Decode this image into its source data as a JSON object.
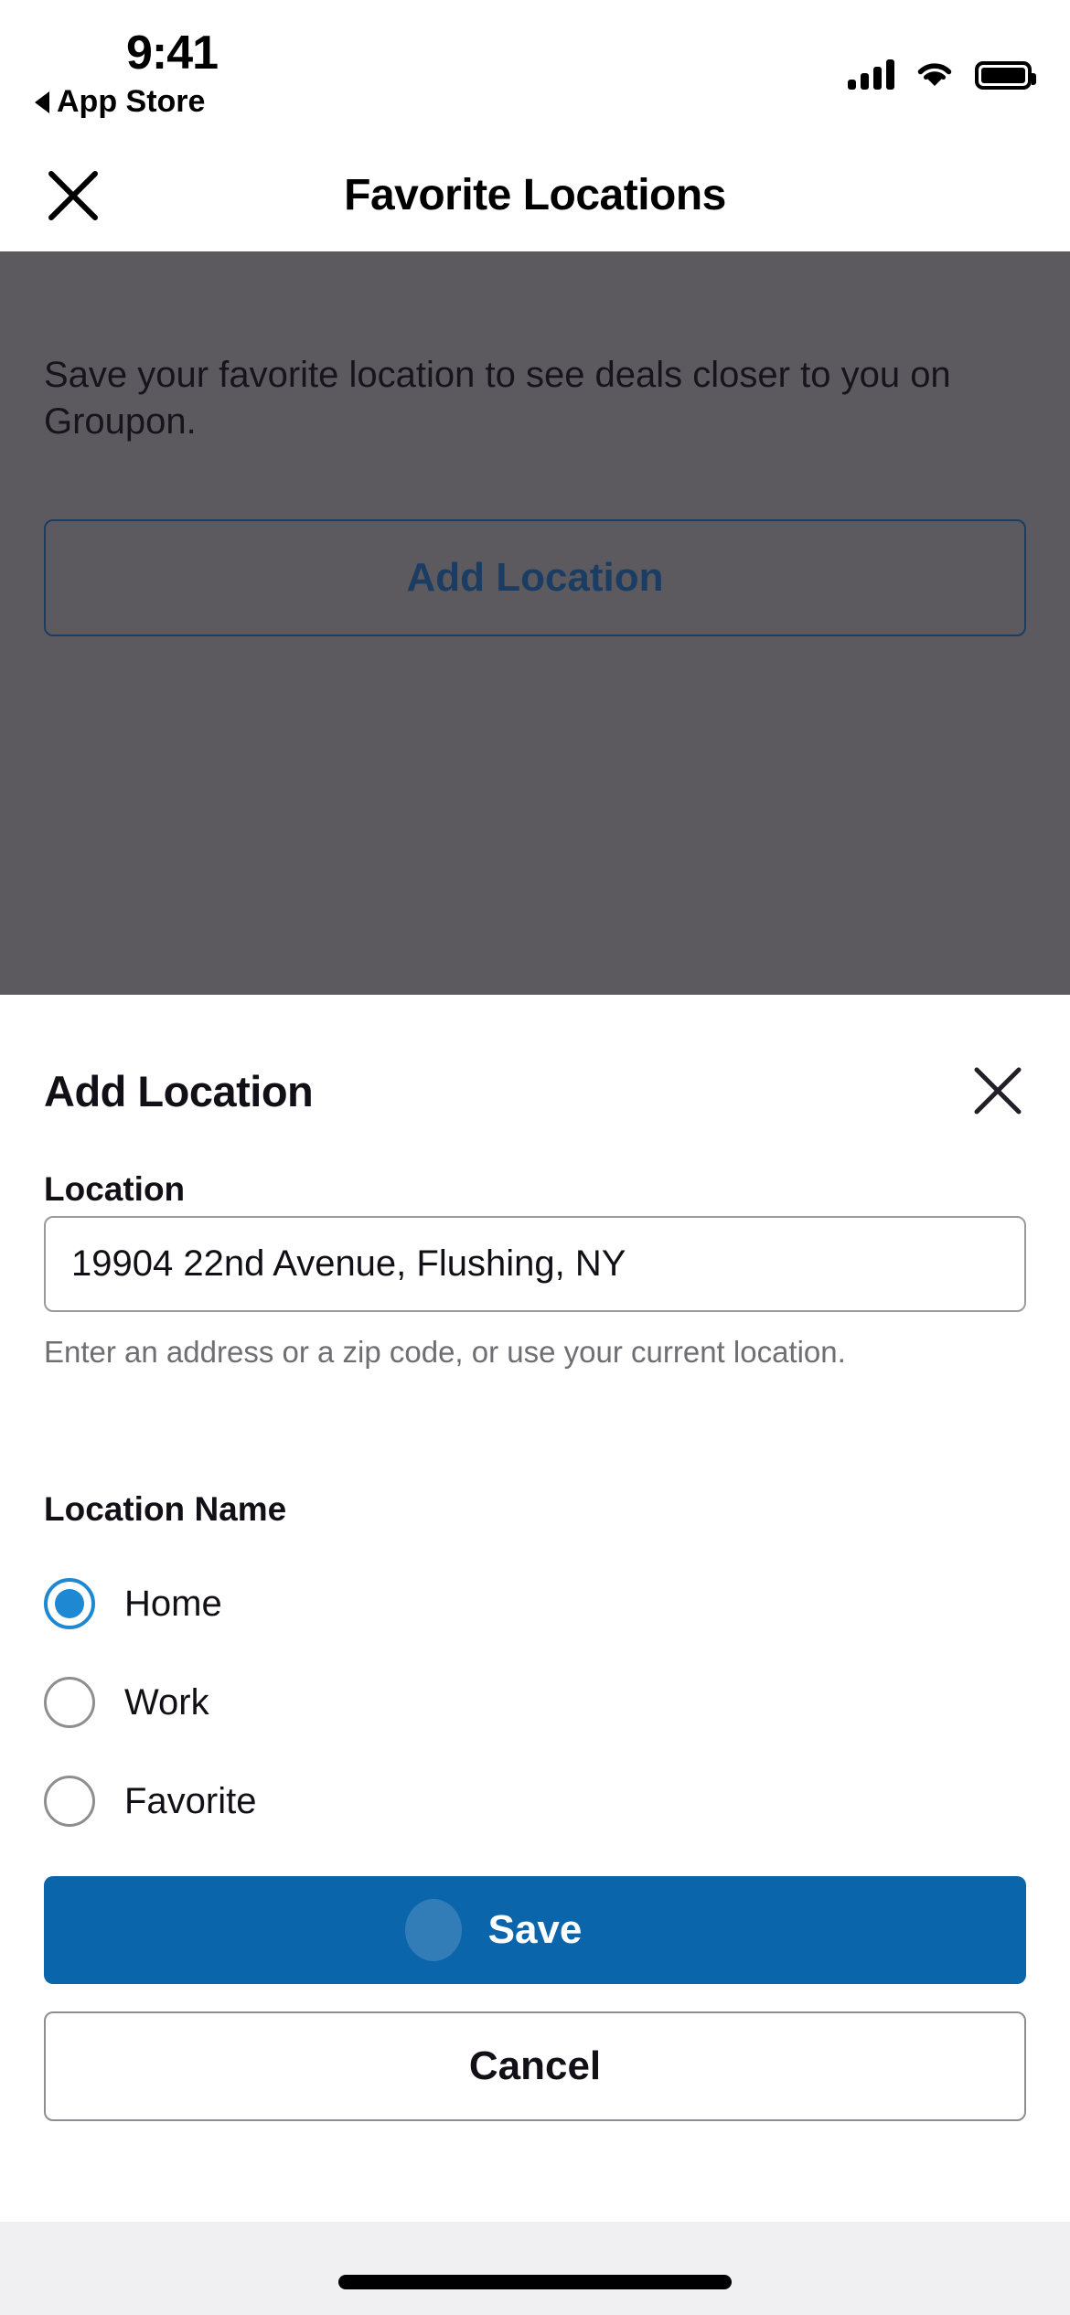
{
  "status_bar": {
    "time": "9:41",
    "back_app_label": "App Store",
    "icons": [
      "cellular-signal-icon",
      "wifi-icon",
      "battery-icon"
    ]
  },
  "nav_header": {
    "title": "Favorite Locations",
    "close_icon": "close-icon"
  },
  "background_page": {
    "description": "Save your favorite location to see deals closer to you on Groupon.",
    "add_location_label": "Add Location",
    "overlay_color": "#5c5a5e"
  },
  "sheet": {
    "title": "Add Location",
    "close_icon": "close-icon",
    "location_field": {
      "label": "Location",
      "value": "19904 22nd Avenue, Flushing, NY",
      "placeholder": "Enter an address or a zip code",
      "help_text": "Enter an address or a zip code, or use your current location."
    },
    "location_name": {
      "label": "Location Name",
      "options": [
        {
          "label": "Home",
          "selected": true
        },
        {
          "label": "Work",
          "selected": false
        },
        {
          "label": "Favorite",
          "selected": false
        }
      ]
    },
    "actions": {
      "save_label": "Save",
      "cancel_label": "Cancel"
    },
    "colors": {
      "primary_blue": "#0b65ab",
      "radio_blue": "#1e88d2",
      "outline_gray": "#8d8d92"
    }
  }
}
